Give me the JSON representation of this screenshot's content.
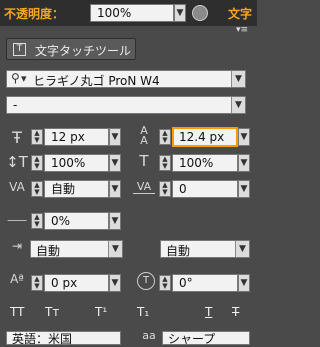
{
  "topbar": {
    "opacity_label": "不透明度：",
    "opacity_value": "100%",
    "char_label": "文字"
  },
  "tool_button": {
    "label": "文字タッチツール"
  },
  "font": {
    "family": "ヒラギノ丸ゴ ProN W4",
    "style": "-"
  },
  "settings": {
    "font_size": "12 px",
    "leading": "12.4 px",
    "vertical_scale": "100%",
    "horizontal_scale": "100%",
    "kerning": "自動",
    "tracking": "0",
    "tsume": "0%",
    "aki_before": "自動",
    "aki_after": "自動",
    "baseline_shift": "0 px",
    "rotation": "0°"
  },
  "style_buttons": {
    "all_caps": "TT",
    "small_caps": "Tт",
    "superscript": "T¹",
    "subscript": "T₁",
    "underline": "T",
    "strikethrough": "T"
  },
  "bottom": {
    "language": "英語：米国",
    "extra": "シャープ"
  }
}
